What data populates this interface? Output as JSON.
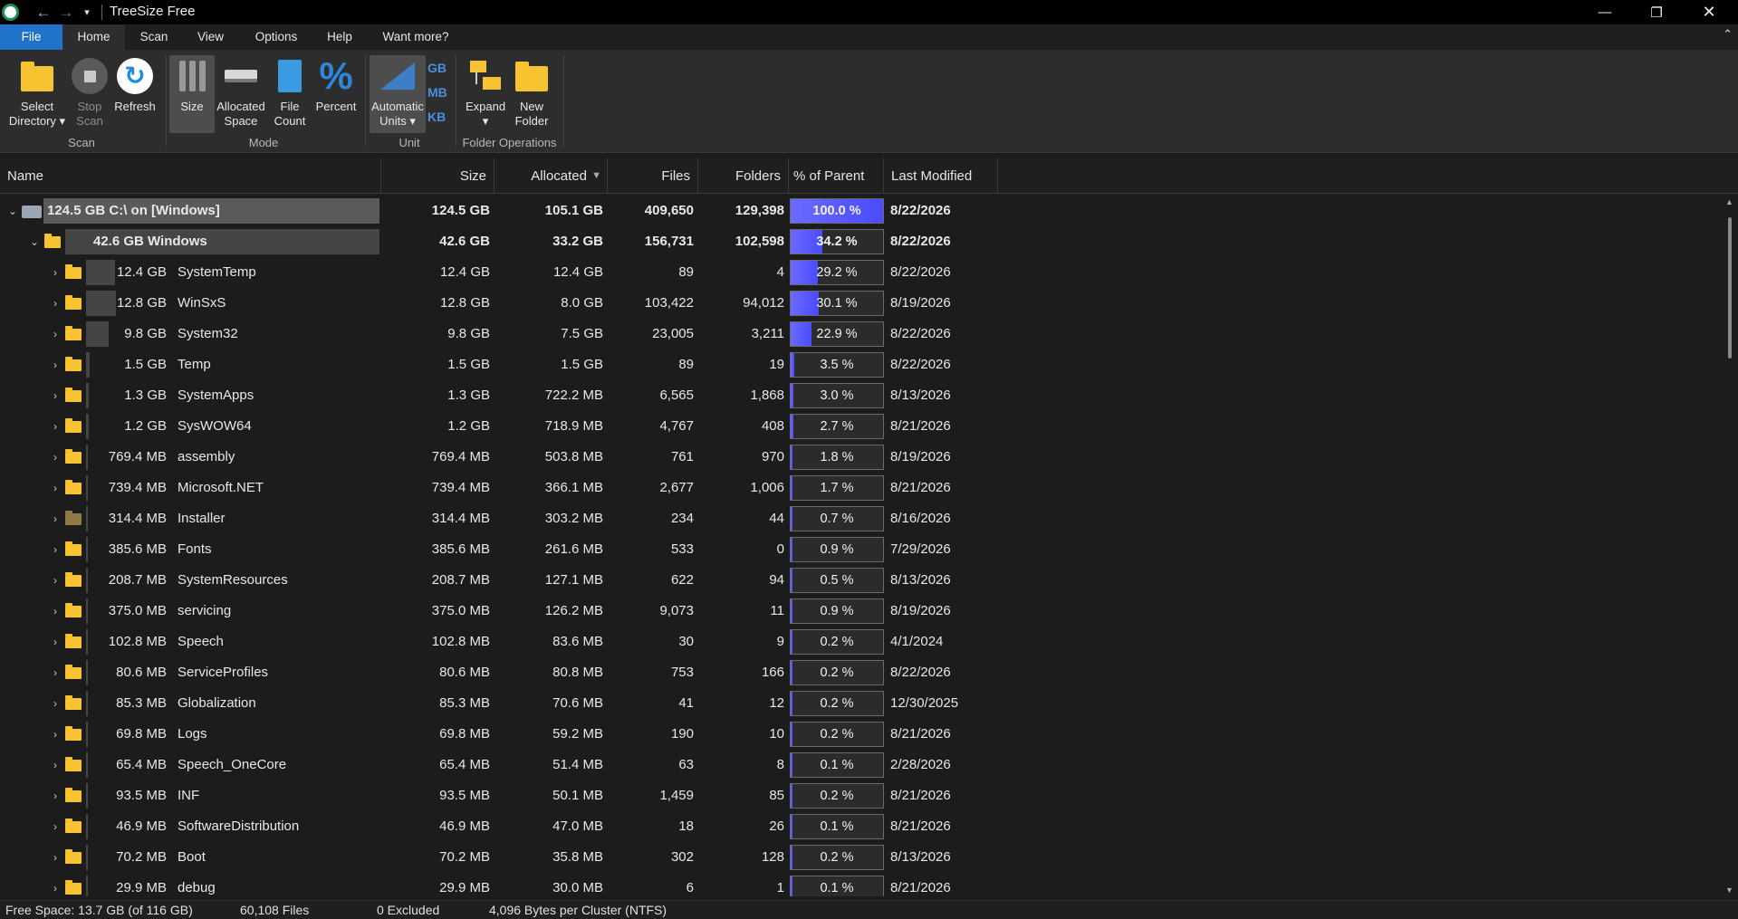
{
  "window": {
    "title": "TreeSize Free"
  },
  "tabs": [
    "File",
    "Home",
    "Scan",
    "View",
    "Options",
    "Help",
    "Want more?"
  ],
  "ribbon": {
    "select_directory": "Select\nDirectory ▾",
    "stop_scan": "Stop\nScan",
    "refresh": "Refresh",
    "size": "Size",
    "allocated_space": "Allocated\nSpace",
    "file_count": "File\nCount",
    "percent": "Percent",
    "automatic_units": "Automatic\nUnits ▾",
    "unit_gb": "GB",
    "unit_mb": "MB",
    "unit_kb": "KB",
    "expand": "Expand\n▾",
    "new_folder": "New\nFolder",
    "groups": {
      "scan": "Scan",
      "mode": "Mode",
      "unit": "Unit",
      "folder_ops": "Folder Operations"
    }
  },
  "columns": {
    "name": "Name",
    "size": "Size",
    "allocated": "Allocated",
    "files": "Files",
    "folders": "Folders",
    "pct_parent": "% of Parent (...",
    "last_modified": "Last Modified"
  },
  "rows": [
    {
      "label": "124.5 GB   C:\\  on  [Windows]",
      "size": "124.5 GB",
      "allocated": "105.1 GB",
      "files": "409,650",
      "folders": "129,398",
      "pct": "100.0 %",
      "pct_value": 100,
      "modified": "8/22/2026"
    },
    {
      "label": "42.6 GB   Windows",
      "size": "42.6 GB",
      "allocated": "33.2 GB",
      "files": "156,731",
      "folders": "102,598",
      "pct": "34.2 %",
      "pct_value": 34.2,
      "modified": "8/22/2026"
    },
    {
      "size_label": "12.4 GB",
      "name": "SystemTemp",
      "size": "12.4 GB",
      "allocated": "12.4 GB",
      "files": "89",
      "folders": "4",
      "pct": "29.2 %",
      "pct_value": 29.2,
      "modified": "8/22/2026"
    },
    {
      "size_label": "12.8 GB",
      "name": "WinSxS",
      "size": "12.8 GB",
      "allocated": "8.0 GB",
      "files": "103,422",
      "folders": "94,012",
      "pct": "30.1 %",
      "pct_value": 30.1,
      "modified": "8/19/2026"
    },
    {
      "size_label": "9.8 GB",
      "name": "System32",
      "size": "9.8 GB",
      "allocated": "7.5 GB",
      "files": "23,005",
      "folders": "3,211",
      "pct": "22.9 %",
      "pct_value": 22.9,
      "modified": "8/22/2026"
    },
    {
      "size_label": "1.5 GB",
      "name": "Temp",
      "size": "1.5 GB",
      "allocated": "1.5 GB",
      "files": "89",
      "folders": "19",
      "pct": "3.5 %",
      "pct_value": 3.5,
      "modified": "8/22/2026"
    },
    {
      "size_label": "1.3 GB",
      "name": "SystemApps",
      "size": "1.3 GB",
      "allocated": "722.2 MB",
      "files": "6,565",
      "folders": "1,868",
      "pct": "3.0 %",
      "pct_value": 3.0,
      "modified": "8/13/2026"
    },
    {
      "size_label": "1.2 GB",
      "name": "SysWOW64",
      "size": "1.2 GB",
      "allocated": "718.9 MB",
      "files": "4,767",
      "folders": "408",
      "pct": "2.7 %",
      "pct_value": 2.7,
      "modified": "8/21/2026"
    },
    {
      "size_label": "769.4 MB",
      "name": "assembly",
      "size": "769.4 MB",
      "allocated": "503.8 MB",
      "files": "761",
      "folders": "970",
      "pct": "1.8 %",
      "pct_value": 1.8,
      "modified": "8/19/2026"
    },
    {
      "size_label": "739.4 MB",
      "name": "Microsoft.NET",
      "size": "739.4 MB",
      "allocated": "366.1 MB",
      "files": "2,677",
      "folders": "1,006",
      "pct": "1.7 %",
      "pct_value": 1.7,
      "modified": "8/21/2026"
    },
    {
      "size_label": "314.4 MB",
      "name": "Installer",
      "size": "314.4 MB",
      "allocated": "303.2 MB",
      "files": "234",
      "folders": "44",
      "pct": "0.7 %",
      "pct_value": 0.7,
      "modified": "8/16/2026",
      "gray": true
    },
    {
      "size_label": "385.6 MB",
      "name": "Fonts",
      "size": "385.6 MB",
      "allocated": "261.6 MB",
      "files": "533",
      "folders": "0",
      "pct": "0.9 %",
      "pct_value": 0.9,
      "modified": "7/29/2026"
    },
    {
      "size_label": "208.7 MB",
      "name": "SystemResources",
      "size": "208.7 MB",
      "allocated": "127.1 MB",
      "files": "622",
      "folders": "94",
      "pct": "0.5 %",
      "pct_value": 0.5,
      "modified": "8/13/2026"
    },
    {
      "size_label": "375.0 MB",
      "name": "servicing",
      "size": "375.0 MB",
      "allocated": "126.2 MB",
      "files": "9,073",
      "folders": "11",
      "pct": "0.9 %",
      "pct_value": 0.9,
      "modified": "8/19/2026"
    },
    {
      "size_label": "102.8 MB",
      "name": "Speech",
      "size": "102.8 MB",
      "allocated": "83.6 MB",
      "files": "30",
      "folders": "9",
      "pct": "0.2 %",
      "pct_value": 0.2,
      "modified": "4/1/2024"
    },
    {
      "size_label": "80.6 MB",
      "name": "ServiceProfiles",
      "size": "80.6 MB",
      "allocated": "80.8 MB",
      "files": "753",
      "folders": "166",
      "pct": "0.2 %",
      "pct_value": 0.2,
      "modified": "8/22/2026"
    },
    {
      "size_label": "85.3 MB",
      "name": "Globalization",
      "size": "85.3 MB",
      "allocated": "70.6 MB",
      "files": "41",
      "folders": "12",
      "pct": "0.2 %",
      "pct_value": 0.2,
      "modified": "12/30/2025"
    },
    {
      "size_label": "69.8 MB",
      "name": "Logs",
      "size": "69.8 MB",
      "allocated": "59.2 MB",
      "files": "190",
      "folders": "10",
      "pct": "0.2 %",
      "pct_value": 0.2,
      "modified": "8/21/2026"
    },
    {
      "size_label": "65.4 MB",
      "name": "Speech_OneCore",
      "size": "65.4 MB",
      "allocated": "51.4 MB",
      "files": "63",
      "folders": "8",
      "pct": "0.1 %",
      "pct_value": 0.1,
      "modified": "2/28/2026"
    },
    {
      "size_label": "93.5 MB",
      "name": "INF",
      "size": "93.5 MB",
      "allocated": "50.1 MB",
      "files": "1,459",
      "folders": "85",
      "pct": "0.2 %",
      "pct_value": 0.2,
      "modified": "8/21/2026"
    },
    {
      "size_label": "46.9 MB",
      "name": "SoftwareDistribution",
      "size": "46.9 MB",
      "allocated": "47.0 MB",
      "files": "18",
      "folders": "26",
      "pct": "0.1 %",
      "pct_value": 0.1,
      "modified": "8/21/2026"
    },
    {
      "size_label": "70.2 MB",
      "name": "Boot",
      "size": "70.2 MB",
      "allocated": "35.8 MB",
      "files": "302",
      "folders": "128",
      "pct": "0.2 %",
      "pct_value": 0.2,
      "modified": "8/13/2026"
    },
    {
      "size_label": "29.9 MB",
      "name": "debug",
      "size": "29.9 MB",
      "allocated": "30.0 MB",
      "files": "6",
      "folders": "1",
      "pct": "0.1 %",
      "pct_value": 0.1,
      "modified": "8/21/2026"
    }
  ],
  "status": {
    "free_space": "Free Space: 13.7 GB  (of 116 GB)",
    "files": "60,108 Files",
    "excluded": "0 Excluded",
    "cluster": "4,096 Bytes per Cluster (NTFS)"
  }
}
